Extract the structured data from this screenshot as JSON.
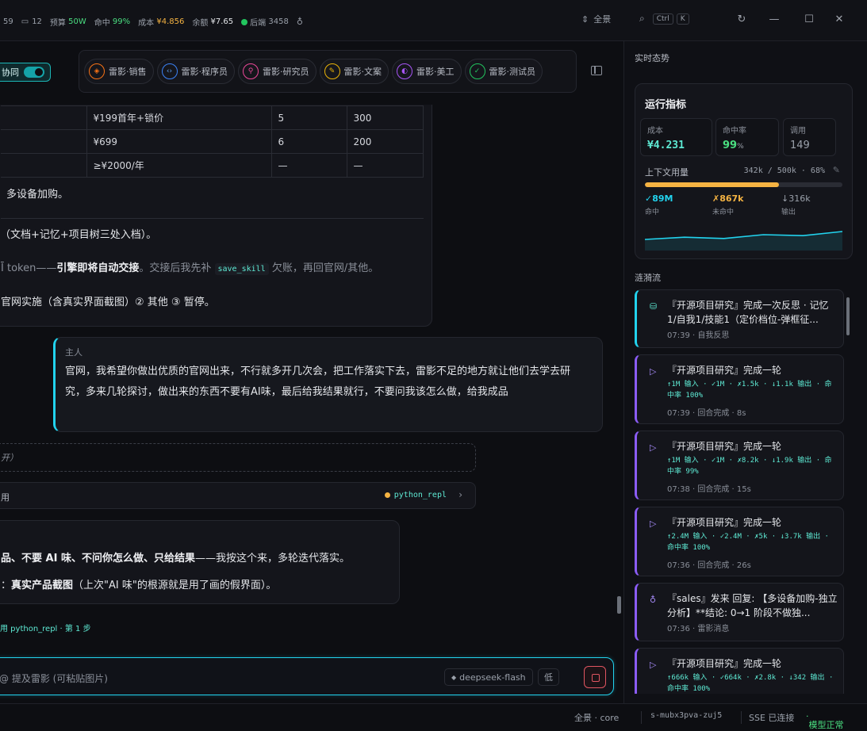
{
  "topbar": {
    "count_a": "59",
    "comments": "12",
    "budget_label": "预算",
    "budget_value": "50W",
    "hit_label": "命中",
    "hit_value": "99%",
    "cost_label": "成本",
    "cost_value": "¥4.856",
    "balance_label": "余额",
    "balance_value": "¥7.65",
    "backend_label": "后端",
    "backend_value": "3458",
    "fullview": "全景",
    "kbd_ctrl": "Ctrl",
    "kbd_k": "K"
  },
  "agents": {
    "collab_label": "协同",
    "items": [
      {
        "label": "雷影·销售",
        "color": "#f97316"
      },
      {
        "label": "雷影·程序员",
        "color": "#3b82f6"
      },
      {
        "label": "雷影·研究员",
        "color": "#ec4899"
      },
      {
        "label": "雷影·文案",
        "color": "#eab308"
      },
      {
        "label": "雷影·美工",
        "color": "#a855f7"
      },
      {
        "label": "雷影·测试员",
        "color": "#22c55e"
      }
    ]
  },
  "chat": {
    "table": [
      [
        "¥199首年+锁价",
        "5",
        "300"
      ],
      [
        "¥699",
        "6",
        "200"
      ],
      [
        "≥¥2000/年",
        "—",
        "—"
      ]
    ],
    "line1": "多设备加购。",
    "line2": "（文档+记忆+项目树三处入档）。",
    "line3_a": "Ī token——",
    "line3_b": "引擎即将自动交接",
    "line3_c": "。交接后我先补",
    "line3_code": "save_skill",
    "line3_d": "欠账，再回官网/其他。",
    "line4": "官网实施（含真实界面截图）② 其他 ③ 暂停。",
    "user_who": "主人",
    "user_msg": "官网，我希望你做出优质的官网出来，不行就多开几次会，把工作落实下去，雷影不足的地方就让他们去学去研究，多来几轮探讨，做出来的东西不要有AI味，最后给我结果就行，不要问我该怎么做，给我成品",
    "dashed_text": "开）",
    "tool_row_label": "用",
    "tool_name": "python_repl",
    "reply_a": "品、不要 AI 味、不问你怎么做、只给结果",
    "reply_b": "——我按这个来，多轮迭代落实。",
    "reply2_a": "：",
    "reply2_b": "真实产品截图",
    "reply2_c": "（上次\"AI 味\"的根源就是用了画的假界面）。",
    "step": "用 python_repl · 第 1 步"
  },
  "input": {
    "placeholder": "@ 提及雷影   (可粘贴图片)",
    "model": "deepseek-flash",
    "level": "低"
  },
  "panel": {
    "title": "实时态势",
    "metrics_title": "运行指标",
    "cost_label": "成本",
    "cost_value": "¥4.231",
    "hit_label": "命中率",
    "hit_value": "99",
    "hit_unit": "%",
    "calls_label": "调用",
    "calls_value": "149",
    "usage_label": "上下文用量",
    "usage_value": "342k / 500k · 68%",
    "usage_pct": 68,
    "tok_hit": "✓89M",
    "tok_hit_label": "命中",
    "tok_miss": "✗867k",
    "tok_miss_label": "未命中",
    "tok_out": "↓316k",
    "tok_out_label": "输出",
    "spark": [
      0.35,
      0.42,
      0.38,
      0.5,
      0.47,
      0.6
    ],
    "feed_title": "涟漪流",
    "feed": [
      {
        "kind": "teal",
        "icon": "database-icon",
        "title": "『开源项目研究』完成一次反思 · 记忆1/自我1/技能1（定价档位-弹框征...",
        "stat": "",
        "meta": "07:39 · 自我反思"
      },
      {
        "kind": "violet",
        "icon": "play-icon",
        "title": "『开源项目研究』完成一轮",
        "stat": "↑1M 输入 · ✓1M · ✗1.5k · ↓1.1k 输出 · 命中率 100%",
        "meta": "07:39 · 回合完成 · 8s"
      },
      {
        "kind": "violet",
        "icon": "play-icon",
        "title": "『开源项目研究』完成一轮",
        "stat": "↑1M 输入 · ✓1M · ✗8.2k · ↓1.9k 输出 · 命中率 99%",
        "meta": "07:38 · 回合完成 · 15s"
      },
      {
        "kind": "violet",
        "icon": "play-icon",
        "title": "『开源项目研究』完成一轮",
        "stat": "↑2.4M 输入 · ✓2.4M · ✗5k · ↓3.7k 输出 · 命中率 100%",
        "meta": "07:36 · 回合完成 · 26s"
      },
      {
        "kind": "violet",
        "icon": "bulb-icon",
        "title": "『sales』发来 回复: 【多设备加购-独立分析】**结论: 0→1 阶段不做独...",
        "stat": "",
        "meta": "07:36 · 雷影消息"
      },
      {
        "kind": "violet",
        "icon": "play-icon",
        "title": "『开源项目研究』完成一轮",
        "stat": "↑666k 输入 · ✓664k · ✗2.8k · ↓342 输出 · 命中率 100%",
        "meta": ""
      }
    ]
  },
  "status": {
    "view": "全景 · core",
    "session": "s-mubx3pva-zuj5",
    "sse": "SSE 已连接",
    "model_ok": "模型正常"
  }
}
